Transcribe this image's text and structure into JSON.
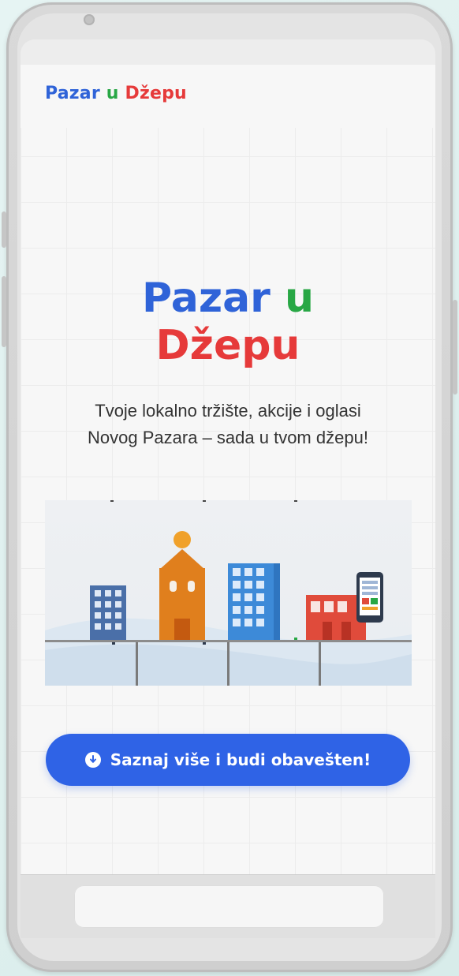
{
  "header": {
    "logo": {
      "part1": "Pazar",
      "part2": "u",
      "part3": "Džepu"
    }
  },
  "hero": {
    "title_line1_a": "Pazar",
    "title_line1_b": "u",
    "title_line2": "Džepu",
    "subtitle_line1": "Tvoje lokalno tržište, akcije i oglasi",
    "subtitle_line2": "Novog Pazara – sada u tvom džepu!"
  },
  "cta": {
    "label": "Saznaj više i budi obavešten!",
    "icon": "arrow-down-circle-icon"
  },
  "illustration": {
    "icon": "city-market-illustration"
  },
  "colors": {
    "brand_blue": "#2f63d8",
    "brand_green": "#28a745",
    "brand_red": "#e63a3a",
    "cta_blue": "#2f63e6"
  }
}
